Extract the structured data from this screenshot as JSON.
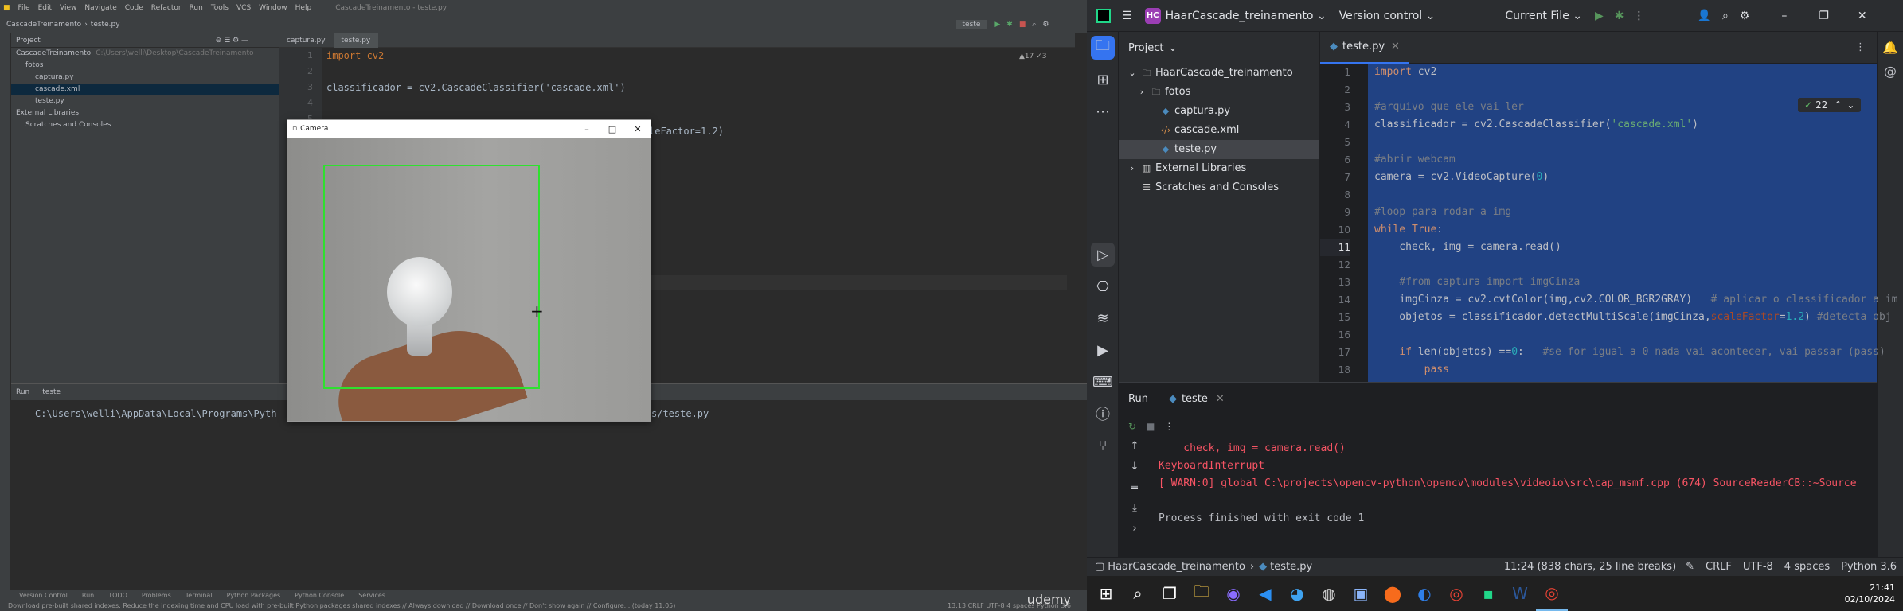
{
  "left_ide": {
    "menu": [
      "File",
      "Edit",
      "View",
      "Navigate",
      "Code",
      "Refactor",
      "Run",
      "Tools",
      "VCS",
      "Window",
      "Help"
    ],
    "window_title": "CascadeTreinamento - teste.py",
    "breadcrumb": [
      "CascadeTreinamento",
      "teste.py"
    ],
    "run_config": "teste",
    "project_label": "Project",
    "tree": [
      {
        "label": "CascadeTreinamento",
        "detail": "C:\\Users\\welli\\Desktop\\CascadeTreinamento",
        "indent": 0
      },
      {
        "label": "fotos",
        "indent": 1
      },
      {
        "label": "captura.py",
        "indent": 2
      },
      {
        "label": "cascade.xml",
        "indent": 2
      },
      {
        "label": "teste.py",
        "indent": 2
      },
      {
        "label": "External Libraries",
        "indent": 0
      },
      {
        "label": "Scratches and Consoles",
        "indent": 1
      }
    ],
    "tabs": [
      "captura.py",
      "teste.py"
    ],
    "inspection": "▲17 ✓3",
    "gutter": [
      "1",
      "2",
      "3",
      "4",
      "5"
    ],
    "code": [
      "import cv2",
      "",
      "classificador = cv2.CascadeClassifier('cascade.xml')"
    ],
    "code_fragment_1": "leFactor=1.2)",
    "run_label": "Run",
    "run_tab": "teste",
    "run_output": "C:\\Users\\welli\\AppData\\Local\\Programs\\Pyth",
    "run_output_tail": "s/teste.py",
    "tool_tabs": [
      "Version Control",
      "Run",
      "TODO",
      "Problems",
      "Terminal",
      "Python Packages",
      "Python Console",
      "Services"
    ],
    "status_message": "Download pre-built shared indexes: Reduce the indexing time and CPU load with pre-built Python packages shared indexes // Always download // Download once // Don't show again // Configure... (today 11:05)",
    "status_right": "13:13  CRLF  UTF-8  4 spaces  Python 3.6",
    "udemy": "udemy"
  },
  "camera_window": {
    "title": "Camera",
    "box_color": "#2fe12f"
  },
  "right_ide": {
    "project_badge": "HC",
    "project_name": "HaarCascade_treinamento",
    "vcs": "Version control",
    "run_target": "Current File",
    "panel_title": "Project",
    "tree": [
      {
        "label": "HaarCascade_treinamento",
        "icon": "folder-icon",
        "indent": 0,
        "arrow": "⌄"
      },
      {
        "label": "fotos",
        "icon": "folder-icon",
        "indent": 1,
        "arrow": "›"
      },
      {
        "label": "captura.py",
        "icon": "python-file-icon",
        "indent": 2,
        "arrow": ""
      },
      {
        "label": "cascade.xml",
        "icon": "xml-file-icon",
        "indent": 2,
        "arrow": ""
      },
      {
        "label": "teste.py",
        "icon": "python-file-icon",
        "indent": 2,
        "arrow": ""
      },
      {
        "label": "External Libraries",
        "icon": "library-icon",
        "indent": 0,
        "arrow": "›"
      },
      {
        "label": "Scratches and Consoles",
        "icon": "scratch-icon",
        "indent": 0,
        "arrow": ""
      }
    ],
    "tab": "teste.py",
    "inspection_count": "22",
    "gutter": [
      "1",
      "2",
      "3",
      "4",
      "5",
      "6",
      "7",
      "8",
      "9",
      "10",
      "11",
      "12",
      "13",
      "14",
      "15",
      "16",
      "17",
      "18"
    ],
    "run_title": "Run",
    "run_tab": "teste",
    "output": [
      "    check, img = camera.read()",
      "KeyboardInterrupt",
      "[ WARN:0] global C:\\projects\\opencv-python\\opencv\\modules\\videoio\\src\\cap_msmf.cpp (674) SourceReaderCB::~Source",
      "",
      "Process finished with exit code 1"
    ],
    "status": {
      "crumb_project": "HaarCascade_treinamento",
      "crumb_file": "teste.py",
      "position": "11:24 (838 chars, 25 line breaks)",
      "line_sep": "CRLF",
      "encoding": "UTF-8",
      "indent": "4 spaces",
      "interpreter": "Python 3.6"
    },
    "clock_time": "21:41",
    "clock_date": "02/10/2024"
  }
}
